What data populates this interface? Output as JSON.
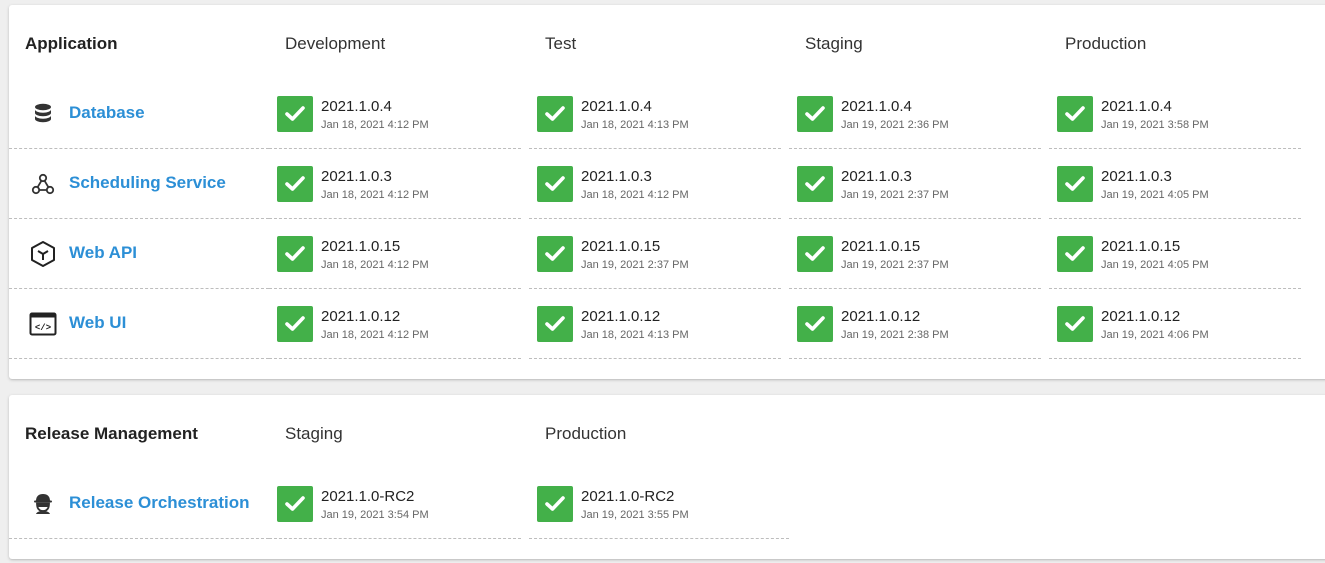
{
  "application_card": {
    "headers": {
      "application": "Application",
      "environments": [
        "Development",
        "Test",
        "Staging",
        "Production"
      ]
    },
    "rows": [
      {
        "name": "Database",
        "icon": "database-icon",
        "deployments": [
          {
            "version": "2021.1.0.4",
            "timestamp": "Jan 18, 2021 4:12 PM"
          },
          {
            "version": "2021.1.0.4",
            "timestamp": "Jan 18, 2021 4:13 PM"
          },
          {
            "version": "2021.1.0.4",
            "timestamp": "Jan 19, 2021 2:36 PM"
          },
          {
            "version": "2021.1.0.4",
            "timestamp": "Jan 19, 2021 3:58 PM"
          }
        ]
      },
      {
        "name": "Scheduling Service",
        "icon": "webhook-icon",
        "deployments": [
          {
            "version": "2021.1.0.3",
            "timestamp": "Jan 18, 2021 4:12 PM"
          },
          {
            "version": "2021.1.0.3",
            "timestamp": "Jan 18, 2021 4:12 PM"
          },
          {
            "version": "2021.1.0.3",
            "timestamp": "Jan 19, 2021 2:37 PM"
          },
          {
            "version": "2021.1.0.3",
            "timestamp": "Jan 19, 2021 4:05 PM"
          }
        ]
      },
      {
        "name": "Web API",
        "icon": "api-cube-icon",
        "deployments": [
          {
            "version": "2021.1.0.15",
            "timestamp": "Jan 18, 2021 4:12 PM"
          },
          {
            "version": "2021.1.0.15",
            "timestamp": "Jan 19, 2021 2:37 PM"
          },
          {
            "version": "2021.1.0.15",
            "timestamp": "Jan 19, 2021 2:37 PM"
          },
          {
            "version": "2021.1.0.15",
            "timestamp": "Jan 19, 2021 4:05 PM"
          }
        ]
      },
      {
        "name": "Web UI",
        "icon": "code-window-icon",
        "deployments": [
          {
            "version": "2021.1.0.12",
            "timestamp": "Jan 18, 2021 4:12 PM"
          },
          {
            "version": "2021.1.0.12",
            "timestamp": "Jan 18, 2021 4:13 PM"
          },
          {
            "version": "2021.1.0.12",
            "timestamp": "Jan 19, 2021 2:38 PM"
          },
          {
            "version": "2021.1.0.12",
            "timestamp": "Jan 19, 2021 4:06 PM"
          }
        ]
      }
    ]
  },
  "release_card": {
    "headers": {
      "application": "Release Management",
      "environments": [
        "Staging",
        "Production"
      ]
    },
    "rows": [
      {
        "name": "Release Orchestration",
        "icon": "agent-icon",
        "deployments": [
          {
            "version": "2021.1.0-RC2",
            "timestamp": "Jan 19, 2021 3:54 PM"
          },
          {
            "version": "2021.1.0-RC2",
            "timestamp": "Jan 19, 2021 3:55 PM"
          }
        ]
      }
    ]
  },
  "colors": {
    "success": "#43b049",
    "link": "#2c8fd6"
  }
}
